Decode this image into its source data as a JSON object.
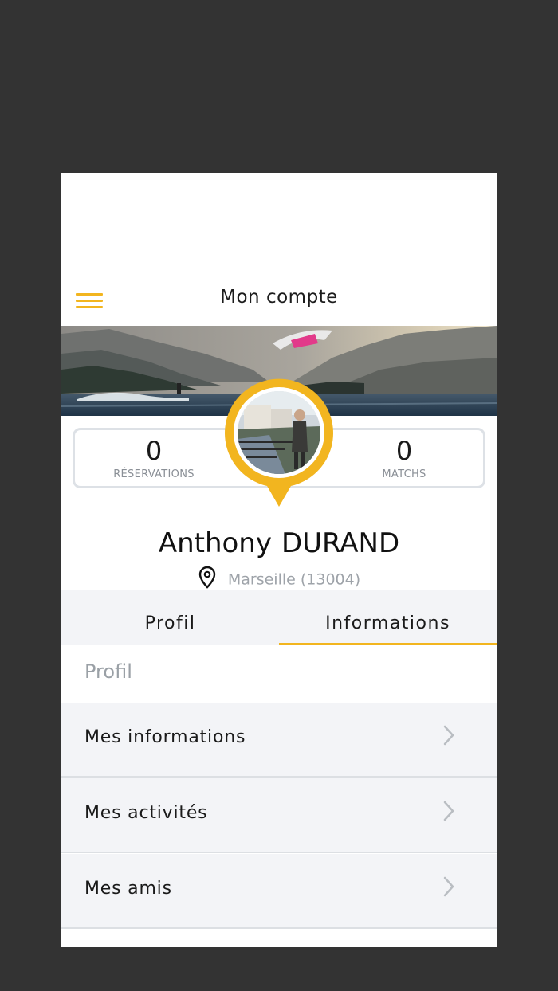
{
  "header": {
    "title": "Mon compte",
    "menu_icon": "hamburger-menu-icon",
    "accent": "#f2b51f"
  },
  "stats": {
    "reservations": {
      "value": "0",
      "label": "RÉSERVATIONS"
    },
    "matchs": {
      "value": "0",
      "label": "MATCHS"
    }
  },
  "user": {
    "first_name": "Anthony",
    "last_name": "DURAND",
    "location": "Marseille (13004)"
  },
  "tabs": [
    {
      "label": "Profil",
      "active": false
    },
    {
      "label": "Informations",
      "active": true
    }
  ],
  "section_title": "Profil",
  "menu_items": [
    {
      "label": "Mes informations"
    },
    {
      "label": "Mes activités"
    },
    {
      "label": "Mes amis"
    }
  ]
}
